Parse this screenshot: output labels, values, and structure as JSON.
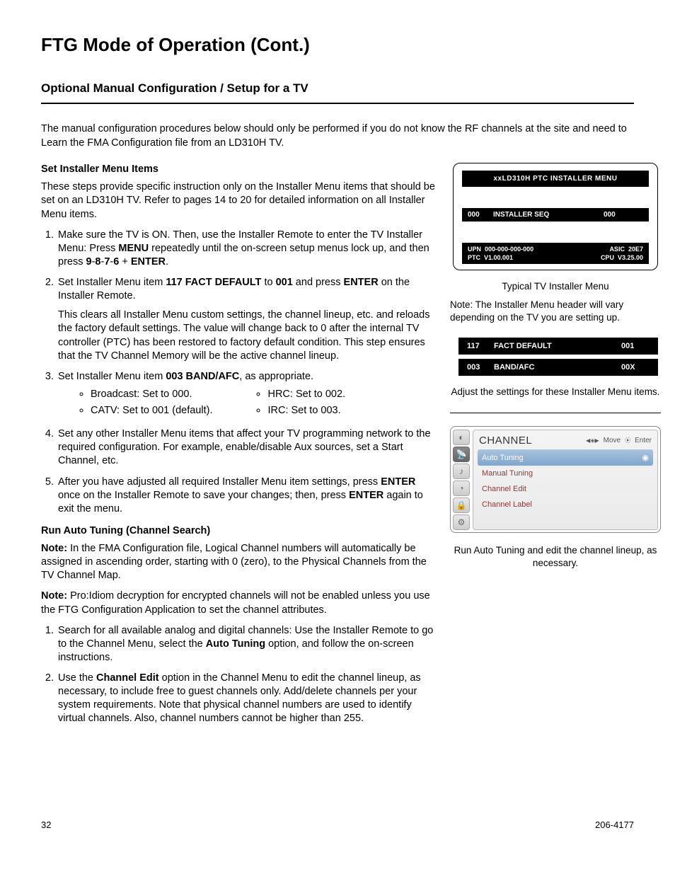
{
  "header": {
    "title": "FTG Mode of Operation (Cont.)",
    "subtitle": "Optional Manual Configuration / Setup for a TV"
  },
  "intro": "The manual configuration procedures below should only be performed if you do not know the RF channels at the site and need to Learn the FMA Configuration file from an LD310H TV.",
  "section1": {
    "heading": "Set Installer Menu Items",
    "para": "These steps provide speciﬁc instruction only on the Installer Menu items that should be set on an LD310H TV. Refer to pages 14 to 20 for detailed information on all Installer Menu items.",
    "step1a": "Make sure the TV is ON. Then, use the Installer Remote to enter the TV Installer Menu: Press ",
    "step1b_bold": "MENU",
    "step1c": " repeatedly until the on-screen setup menus lock up, and then press ",
    "step1d_bold": "9",
    "step1dash1": "-",
    "step1e_bold": "8",
    "step1dash2": "-",
    "step1f_bold": "7",
    "step1dash3": "-",
    "step1g_bold": "6",
    "step1plus": " + ",
    "step1h_bold": "ENTER",
    "step1i": ".",
    "step2a": "Set Installer Menu item ",
    "step2b_bold": "117 FACT DEFAULT",
    "step2c": " to ",
    "step2d_bold": "001",
    "step2e": " and press ",
    "step2f_bold": "ENTER",
    "step2g": " on the Installer Remote.",
    "step2sub": "This clears all Installer Menu custom settings, the channel lineup, etc. and reloads the factory default settings. The value will change back to 0 after the internal TV controller (PTC) has been restored to factory default condition. This step ensures that the TV Channel Memory will be the active channel lineup.",
    "step3a": "Set Installer Menu item ",
    "step3b_bold": "003 BAND/AFC",
    "step3c": ", as appropriate.",
    "bullets_left": [
      "Broadcast: Set to 000.",
      "CATV: Set to 001 (default)."
    ],
    "bullets_right": [
      "HRC: Set to 002.",
      "IRC: Set to 003."
    ],
    "step4": "Set any other Installer Menu items that affect your TV programming network to the required conﬁguration. For example, enable/disable Aux sources, set a Start Channel, etc.",
    "step5a": "After you have adjusted all required Installer Menu item settings, press ",
    "step5b_bold": "ENTER",
    "step5c": " once on the Installer Remote to save your changes; then, press ",
    "step5d_bold": "ENTER",
    "step5e": " again to exit the menu."
  },
  "section2": {
    "heading": "Run Auto Tuning (Channel Search)",
    "note1a_bold": "Note:",
    "note1b": " In the FMA Conﬁguration ﬁle, Logical Channel numbers will automatically be assigned in ascending order, starting with 0 (zero), to the Physical Channels from the TV Channel Map.",
    "note2a_bold": "Note:",
    "note2b": " Pro:Idiom decryption for encrypted channels will not be enabled unless you use the FTG Conﬁguration Application to set the channel attributes.",
    "step1a": "Search for all available analog and digital channels: Use the Installer Remote to go to the Channel Menu, select the ",
    "step1b_bold": "Auto Tuning",
    "step1c": " option, and follow the on-screen instructions.",
    "step2a": "Use the ",
    "step2b_bold": "Channel Edit",
    "step2c": " option in the Channel Menu to edit the channel lineup, as necessary, to include free to guest channels only. Add/delete channels per your system requirements. Note that physical channel numbers are used to identify virtual channels. Also, channel numbers cannot be higher than 255."
  },
  "panel": {
    "header": "xxLD310H  PTC  INSTALLER  MENU",
    "row_code": "000",
    "row_label": "INSTALLER SEQ",
    "row_val": "000",
    "upn_label": "UPN",
    "upn_val": "000-000-000-000",
    "asic_label": "ASIC",
    "asic_val": "20E7",
    "ptc_label": "PTC",
    "ptc_val": "V1.00.001",
    "cpu_label": "CPU",
    "cpu_val": "V3.25.00"
  },
  "panel_caption": "Typical TV Installer Menu",
  "panel_note": "Note: The Installer Menu header will vary depending on the TV you are setting up.",
  "bars": [
    {
      "code": "117",
      "label": "FACT DEFAULT",
      "val": "001"
    },
    {
      "code": "003",
      "label": "BAND/AFC",
      "val": "00X"
    }
  ],
  "bars_caption": "Adjust the settings for these Installer Menu items.",
  "channel": {
    "title": "CHANNEL",
    "hint_move": "Move",
    "hint_enter": "Enter",
    "items": [
      "Auto Tuning",
      "Manual Tuning",
      "Channel Edit",
      "Channel Label"
    ]
  },
  "channel_caption": "Run Auto Tuning and edit the channel lineup, as necessary.",
  "footer": {
    "page": "32",
    "doc": "206-4177"
  }
}
